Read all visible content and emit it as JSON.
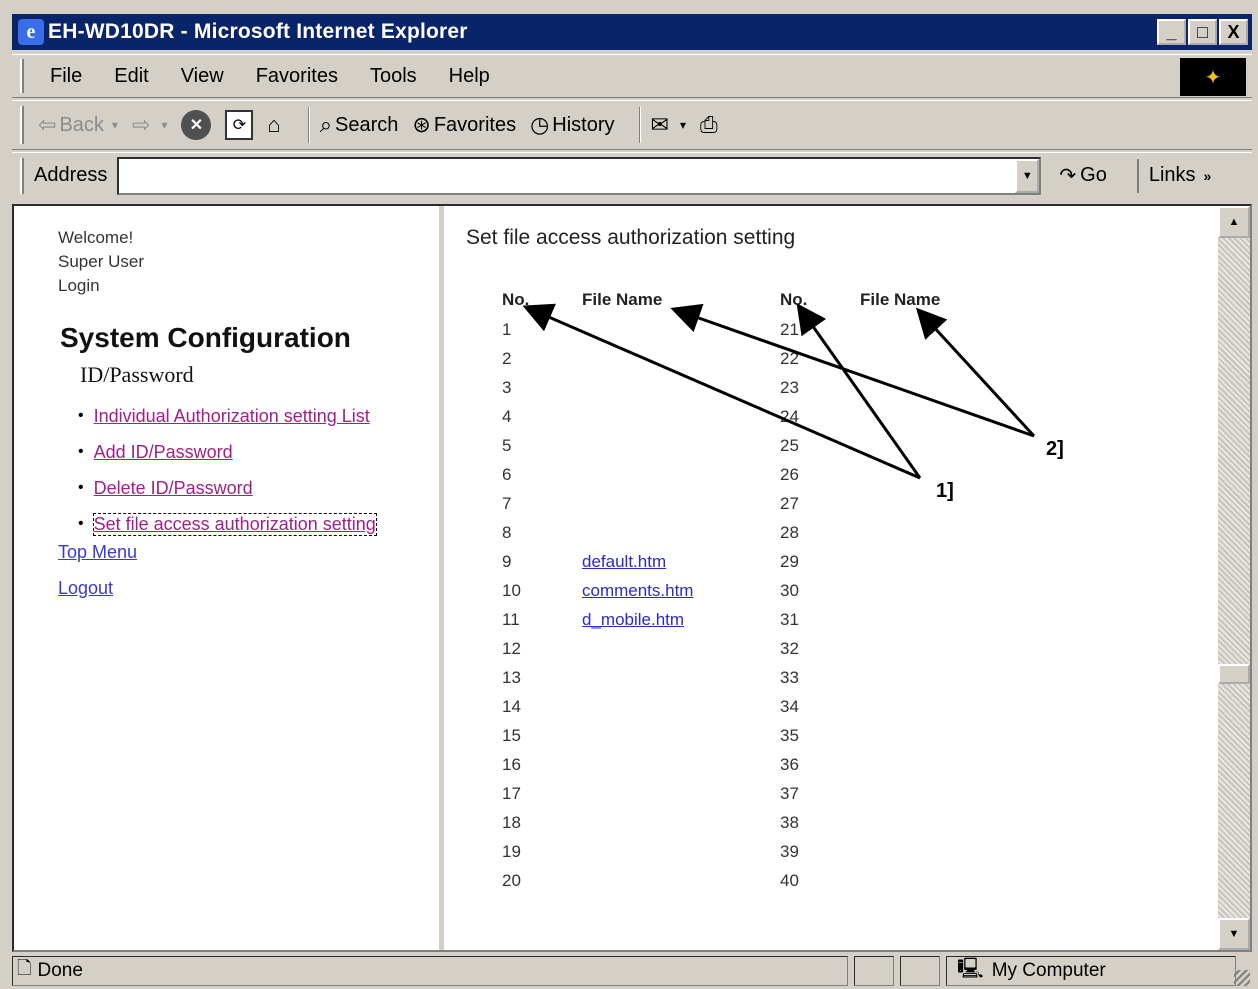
{
  "window": {
    "title": "EH-WD10DR - Microsoft Internet Explorer",
    "controls": [
      "_",
      "□",
      "X"
    ]
  },
  "menu": [
    "File",
    "Edit",
    "View",
    "Favorites",
    "Tools",
    "Help"
  ],
  "toolbar": {
    "back": "Back",
    "search": "Search",
    "favorites": "Favorites",
    "history": "History"
  },
  "address": {
    "label": "Address",
    "value": "",
    "go": "Go",
    "links": "Links"
  },
  "left_nav": {
    "welcome": "Welcome!",
    "user": "Super User",
    "login": "Login",
    "section_title": "System Configuration",
    "subsection": "ID/Password",
    "items": [
      "Individual Authorization setting List",
      "Add ID/Password",
      "Delete ID/Password",
      "Set file access authorization setting"
    ],
    "top_menu": "Top Menu",
    "logout": "Logout"
  },
  "main": {
    "heading": "Set file access authorization setting",
    "columns": {
      "no": "No.",
      "file_name": "File Name"
    },
    "left_rows": [
      "1",
      "2",
      "3",
      "4",
      "5",
      "6",
      "7",
      "8",
      "9",
      "10",
      "11",
      "12",
      "13",
      "14",
      "15",
      "16",
      "17",
      "18",
      "19",
      "20"
    ],
    "right_rows": [
      "21",
      "22",
      "23",
      "24",
      "25",
      "26",
      "27",
      "28",
      "29",
      "30",
      "31",
      "32",
      "33",
      "34",
      "35",
      "36",
      "37",
      "38",
      "39",
      "40"
    ],
    "files": [
      {
        "row": 9,
        "name": "default.htm"
      },
      {
        "row": 10,
        "name": "comments.htm"
      },
      {
        "row": 11,
        "name": "d_mobile.htm"
      }
    ],
    "callouts": [
      "1]",
      "2]"
    ]
  },
  "status": {
    "text": "Done",
    "zone": "My Computer"
  }
}
